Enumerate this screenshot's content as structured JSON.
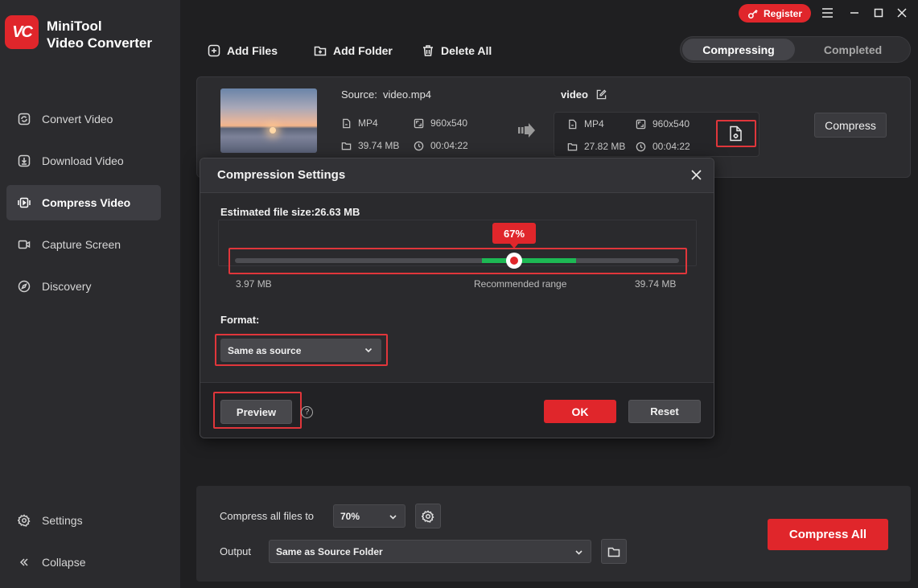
{
  "app": {
    "logo_text": "VC",
    "title_line1": "MiniTool",
    "title_line2": "Video Converter"
  },
  "topbar": {
    "register_label": "Register",
    "menu_icon": "hamburger-icon",
    "minimize_icon": "minimize-icon",
    "maximize_icon": "maximize-icon",
    "close_icon": "close-icon"
  },
  "sidebar": {
    "items": [
      {
        "label": "Convert Video",
        "icon": "convert-icon",
        "active": false
      },
      {
        "label": "Download Video",
        "icon": "download-icon",
        "active": false
      },
      {
        "label": "Compress Video",
        "icon": "compress-icon",
        "active": true
      },
      {
        "label": "Capture Screen",
        "icon": "camera-icon",
        "active": false
      },
      {
        "label": "Discovery",
        "icon": "compass-icon",
        "active": false
      }
    ],
    "settings_label": "Settings",
    "collapse_label": "Collapse"
  },
  "toolbar": {
    "add_files": "Add Files",
    "add_folder": "Add Folder",
    "delete_all": "Delete All"
  },
  "tabs": {
    "compressing": "Compressing",
    "completed": "Completed"
  },
  "file": {
    "source_label": "Source:",
    "source_name": "video.mp4",
    "src_format": "MP4",
    "src_resolution": "960x540",
    "src_size": "39.74 MB",
    "src_duration": "00:04:22",
    "output_name": "video",
    "out_format": "MP4",
    "out_resolution": "960x540",
    "out_size": "27.82 MB",
    "out_duration": "00:04:22",
    "compress_label": "Compress"
  },
  "dialog": {
    "title": "Compression Settings",
    "estimated_label": "Estimated file size:26.63 MB",
    "percent": "67%",
    "slider_value_percent": 67,
    "min_size": "3.97 MB",
    "recommended": "Recommended range",
    "max_size": "39.74 MB",
    "format_label": "Format:",
    "format_value": "Same as source",
    "preview_label": "Preview",
    "help_glyph": "?",
    "ok_label": "OK",
    "reset_label": "Reset"
  },
  "bottom": {
    "compress_all_to_label": "Compress all files to",
    "compress_all_to_value": "70%",
    "output_label": "Output",
    "output_value": "Same as Source Folder",
    "compress_all_label": "Compress All"
  },
  "colors": {
    "accent": "#e0262b",
    "recommended_green": "#1db954",
    "background": "#1f1f21"
  }
}
